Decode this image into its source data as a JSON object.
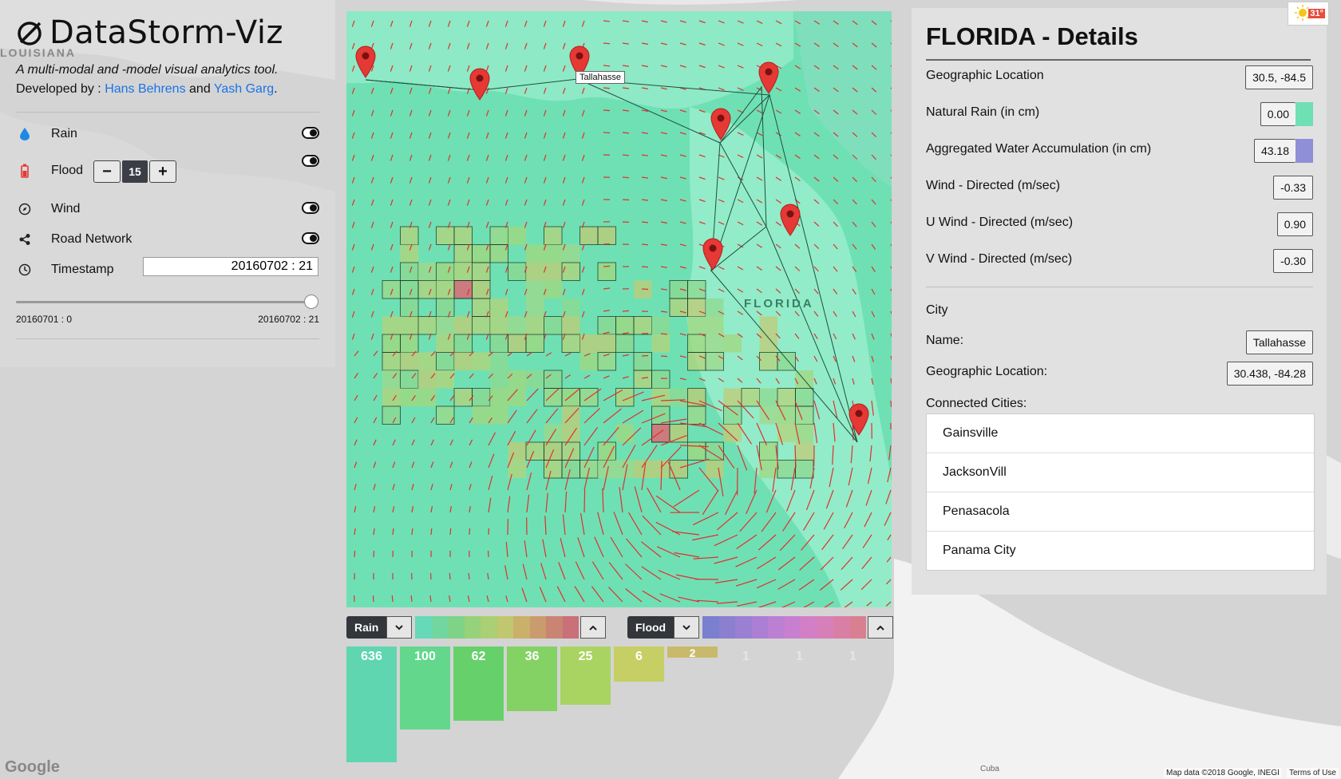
{
  "app": {
    "title": "DataStorm-Viz",
    "subtitle": "A multi-modal and -model visual analytics tool.",
    "developed_by_prefix": "Developed by : ",
    "dev1": "Hans Behrens",
    "dev_and": " and ",
    "dev2": "Yash Garg",
    "dev_end": "."
  },
  "basemap_labels": {
    "louisiana": "LOUISIANA",
    "florida": "FLORIDA",
    "cuba": "Cuba",
    "google": "Google",
    "map_data": "Map data ©2018 Google, INEGI",
    "terms": "Terms of Use"
  },
  "layers": {
    "rain": "Rain",
    "flood": "Flood",
    "flood_value": "15",
    "wind": "Wind",
    "road_network": "Road Network",
    "timestamp_label": "Timestamp",
    "timestamp_value": "20160702 : 21",
    "slider_min": "20160701 : 0",
    "slider_max": "20160702 : 21",
    "slider_progress": 1.0
  },
  "map": {
    "tooltip_city": "Tallahasse"
  },
  "legend": {
    "rain_label": "Rain",
    "flood_label": "Flood",
    "rain_colors": [
      "#66d9b8",
      "#72d69f",
      "#7fd387",
      "#95d27a",
      "#aacf74",
      "#c1c76f",
      "#c9b06b",
      "#ca9b6d",
      "#c98572",
      "#c97079"
    ],
    "flood_colors": [
      "#7b7fcf",
      "#8b7fd0",
      "#9a7fd2",
      "#ab7fd3",
      "#bb7fd3",
      "#c97fd0",
      "#d27fc6",
      "#d77fb8",
      "#d97fa5",
      "#d97f92"
    ]
  },
  "histogram": {
    "values": [
      "636",
      "100",
      "62",
      "36",
      "25",
      "6",
      "2",
      "1",
      "1",
      "1"
    ],
    "counts": [
      636,
      100,
      62,
      36,
      25,
      6,
      2,
      1,
      1,
      1
    ],
    "colors": [
      "#5fd6b0",
      "#63d78c",
      "#66d16a",
      "#84d264",
      "#a9d461",
      "#c6cf63",
      "#c9ba6b",
      "#c9b07b",
      "#c9b08c",
      "#c9b09c"
    ]
  },
  "details": {
    "title": "FLORIDA - Details",
    "geo_location_label": "Geographic Location",
    "geo_location_value": "30.5, -84.5",
    "natural_rain_label": "Natural Rain (in cm)",
    "natural_rain_value": "0.00",
    "natural_rain_color": "#6fe0b4",
    "water_accum_label": "Aggregated Water Accumulation (in cm)",
    "water_accum_value": "43.18",
    "water_accum_color": "#8f8fd8",
    "wind_label": "Wind - Directed (m/sec)",
    "wind_value": "-0.33",
    "u_wind_label": "U Wind - Directed (m/sec)",
    "u_wind_value": "0.90",
    "v_wind_label": "V Wind - Directed (m/sec)",
    "v_wind_value": "-0.30",
    "city_header": "City",
    "city_name_label": "Name:",
    "city_name_value": "Tallahasse",
    "city_geo_label": "Geographic Location:",
    "city_geo_value": "30.438, -84.28",
    "connected_label": "Connected Cities:",
    "connected": [
      "Gainsville",
      "JacksonVill",
      "Penasacola",
      "Panama City"
    ]
  },
  "weather_badge": "31°"
}
